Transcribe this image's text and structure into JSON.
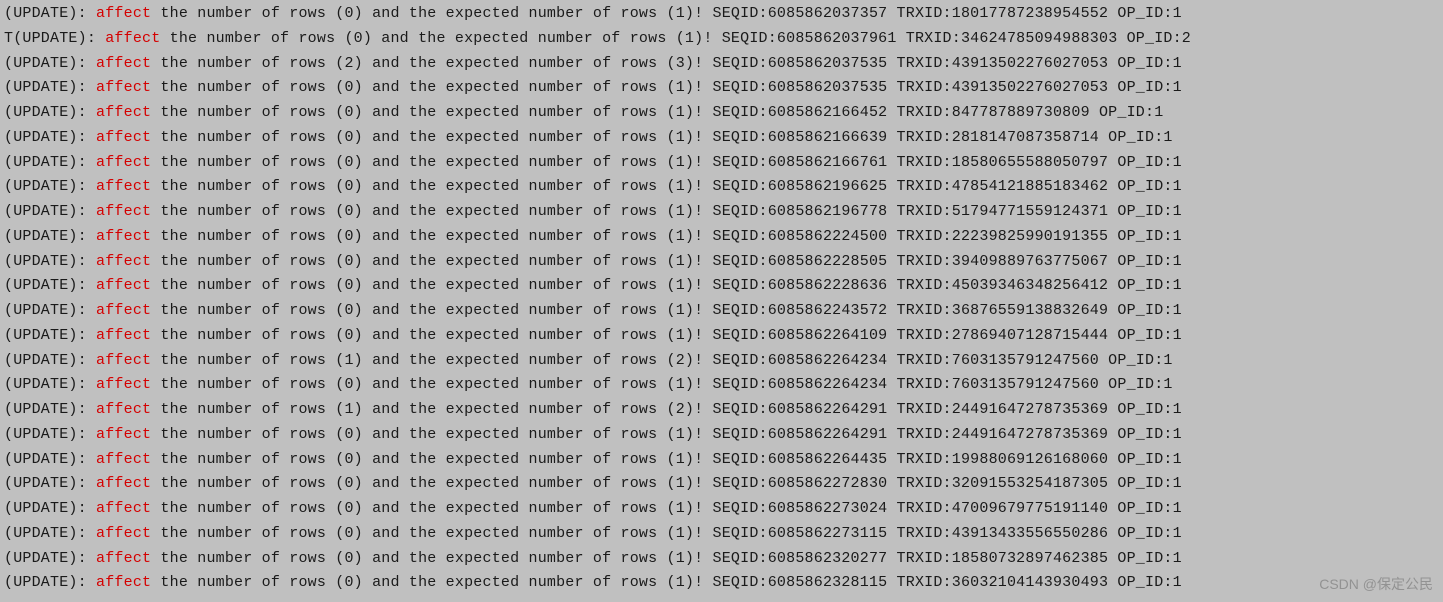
{
  "highlight_word": "affect",
  "watermark": "CSDN @保定公民",
  "log_lines": [
    {
      "prefix": "(UPDATE): ",
      "middle": " the number of rows (0) and the expected number of rows (1)! SEQID:6085862037357 TRXID:18017787238954552 OP_ID:1"
    },
    {
      "prefix": "T(UPDATE): ",
      "middle": " the number of rows (0) and the expected number of rows (1)! SEQID:6085862037961 TRXID:34624785094988303 OP_ID:2"
    },
    {
      "prefix": "(UPDATE): ",
      "middle": " the number of rows (2) and the expected number of rows (3)! SEQID:6085862037535 TRXID:43913502276027053 OP_ID:1"
    },
    {
      "prefix": "(UPDATE): ",
      "middle": " the number of rows (0) and the expected number of rows (1)! SEQID:6085862037535 TRXID:43913502276027053 OP_ID:1"
    },
    {
      "prefix": "(UPDATE): ",
      "middle": " the number of rows (0) and the expected number of rows (1)! SEQID:6085862166452 TRXID:847787889730809 OP_ID:1"
    },
    {
      "prefix": "(UPDATE): ",
      "middle": " the number of rows (0) and the expected number of rows (1)! SEQID:6085862166639 TRXID:2818147087358714 OP_ID:1"
    },
    {
      "prefix": "(UPDATE): ",
      "middle": " the number of rows (0) and the expected number of rows (1)! SEQID:6085862166761 TRXID:18580655588050797 OP_ID:1"
    },
    {
      "prefix": "(UPDATE): ",
      "middle": " the number of rows (0) and the expected number of rows (1)! SEQID:6085862196625 TRXID:47854121885183462 OP_ID:1"
    },
    {
      "prefix": "(UPDATE): ",
      "middle": " the number of rows (0) and the expected number of rows (1)! SEQID:6085862196778 TRXID:51794771559124371 OP_ID:1"
    },
    {
      "prefix": "(UPDATE): ",
      "middle": " the number of rows (0) and the expected number of rows (1)! SEQID:6085862224500 TRXID:22239825990191355 OP_ID:1"
    },
    {
      "prefix": "(UPDATE): ",
      "middle": " the number of rows (0) and the expected number of rows (1)! SEQID:6085862228505 TRXID:39409889763775067 OP_ID:1"
    },
    {
      "prefix": "(UPDATE): ",
      "middle": " the number of rows (0) and the expected number of rows (1)! SEQID:6085862228636 TRXID:45039346348256412 OP_ID:1"
    },
    {
      "prefix": "(UPDATE): ",
      "middle": " the number of rows (0) and the expected number of rows (1)! SEQID:6085862243572 TRXID:36876559138832649 OP_ID:1"
    },
    {
      "prefix": "(UPDATE): ",
      "middle": " the number of rows (0) and the expected number of rows (1)! SEQID:6085862264109 TRXID:27869407128715444 OP_ID:1"
    },
    {
      "prefix": "(UPDATE): ",
      "middle": " the number of rows (1) and the expected number of rows (2)! SEQID:6085862264234 TRXID:7603135791247560 OP_ID:1"
    },
    {
      "prefix": "(UPDATE): ",
      "middle": " the number of rows (0) and the expected number of rows (1)! SEQID:6085862264234 TRXID:7603135791247560 OP_ID:1"
    },
    {
      "prefix": "(UPDATE): ",
      "middle": " the number of rows (1) and the expected number of rows (2)! SEQID:6085862264291 TRXID:24491647278735369 OP_ID:1"
    },
    {
      "prefix": "(UPDATE): ",
      "middle": " the number of rows (0) and the expected number of rows (1)! SEQID:6085862264291 TRXID:24491647278735369 OP_ID:1"
    },
    {
      "prefix": "(UPDATE): ",
      "middle": " the number of rows (0) and the expected number of rows (1)! SEQID:6085862264435 TRXID:19988069126168060 OP_ID:1"
    },
    {
      "prefix": "(UPDATE): ",
      "middle": " the number of rows (0) and the expected number of rows (1)! SEQID:6085862272830 TRXID:32091553254187305 OP_ID:1"
    },
    {
      "prefix": "(UPDATE): ",
      "middle": " the number of rows (0) and the expected number of rows (1)! SEQID:6085862273024 TRXID:47009679775191140 OP_ID:1"
    },
    {
      "prefix": "(UPDATE): ",
      "middle": " the number of rows (0) and the expected number of rows (1)! SEQID:6085862273115 TRXID:43913433556550286 OP_ID:1"
    },
    {
      "prefix": "(UPDATE): ",
      "middle": " the number of rows (0) and the expected number of rows (1)! SEQID:6085862320277 TRXID:18580732897462385 OP_ID:1"
    },
    {
      "prefix": "(UPDATE): ",
      "middle": " the number of rows (0) and the expected number of rows (1)! SEQID:6085862328115 TRXID:36032104143930493 OP_ID:1"
    }
  ]
}
